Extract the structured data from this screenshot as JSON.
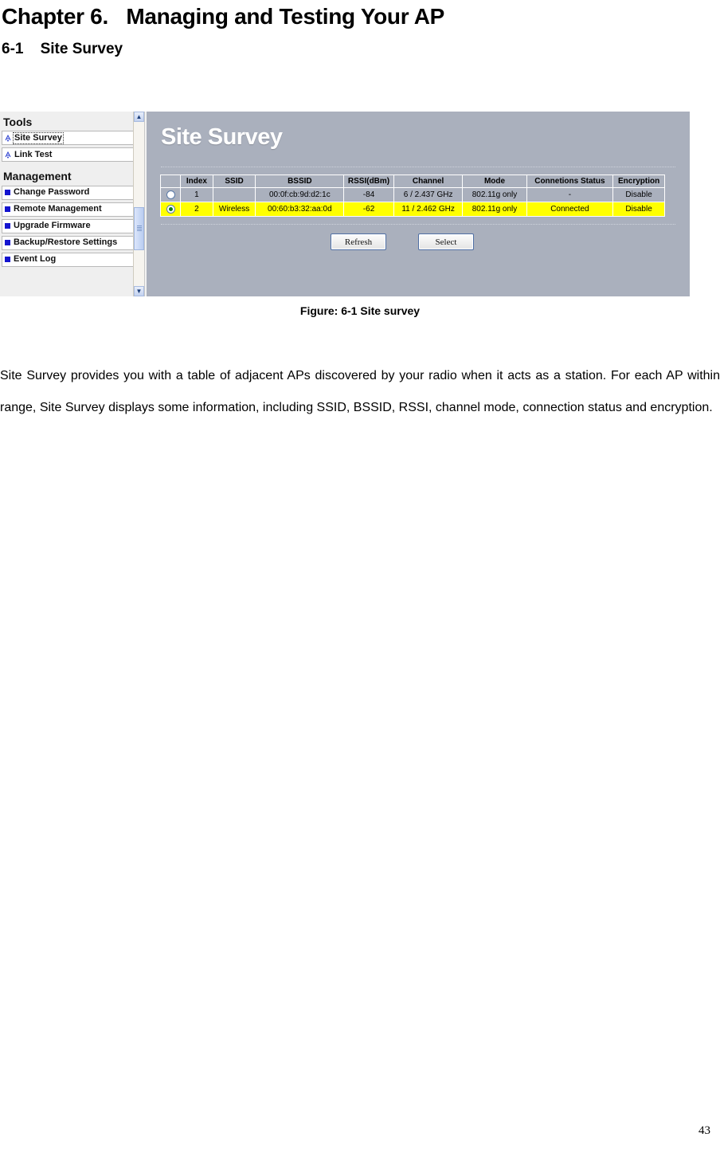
{
  "document": {
    "chapter_title": "Chapter 6.   Managing and Testing Your AP",
    "section_title": "6-1    Site Survey",
    "figure_caption": "Figure: 6-1 Site survey",
    "body_paragraph": "Site Survey provides you with a table of adjacent APs discovered by your radio when it acts as a station. For each AP within range, Site Survey displays some information, including SSID, BSSID, RSSI, channel mode, connection status and encryption.",
    "page_number": "43"
  },
  "app": {
    "sidebar": {
      "groups": [
        {
          "title": "Tools",
          "icon": "antenna-icon",
          "items": [
            {
              "label": "Site Survey",
              "focused": true
            },
            {
              "label": "Link Test",
              "focused": false
            }
          ]
        },
        {
          "title": "Management",
          "icon": "square-bullet-icon",
          "items": [
            {
              "label": "Change Password",
              "focused": false
            },
            {
              "label": "Remote Management",
              "focused": false
            },
            {
              "label": "Upgrade Firmware",
              "focused": false
            },
            {
              "label": "Backup/Restore Settings",
              "focused": false
            },
            {
              "label": "Event Log",
              "focused": false
            }
          ]
        }
      ],
      "scrollbar": {
        "up_arrow": "▲",
        "down_arrow": "▼"
      }
    },
    "main": {
      "title": "Site Survey",
      "table": {
        "columns": [
          "",
          "Index",
          "SSID",
          "BSSID",
          "RSSI(dBm)",
          "Channel",
          "Mode",
          "Connetions Status",
          "Encryption"
        ],
        "rows": [
          {
            "selected": false,
            "highlight": false,
            "index": "1",
            "ssid": "",
            "bssid": "00:0f:cb:9d:d2:1c",
            "rssi": "-84",
            "channel": "6 / 2.437 GHz",
            "mode": "802.11g only",
            "connection_status": "-",
            "encryption": "Disable"
          },
          {
            "selected": true,
            "highlight": true,
            "index": "2",
            "ssid": "Wireless",
            "bssid": "00:60:b3:32:aa:0d",
            "rssi": "-62",
            "channel": "11 / 2.462 GHz",
            "mode": "802.11g only",
            "connection_status": "Connected",
            "encryption": "Disable"
          }
        ]
      },
      "buttons": {
        "refresh": "Refresh",
        "select": "Select"
      }
    },
    "colors": {
      "panel_background": "#aab0bd",
      "sidebar_background": "#efefef",
      "highlight_row": "#ffff00",
      "bullet_blue": "#1414cf",
      "radio_selected": "#0b7a16"
    }
  }
}
